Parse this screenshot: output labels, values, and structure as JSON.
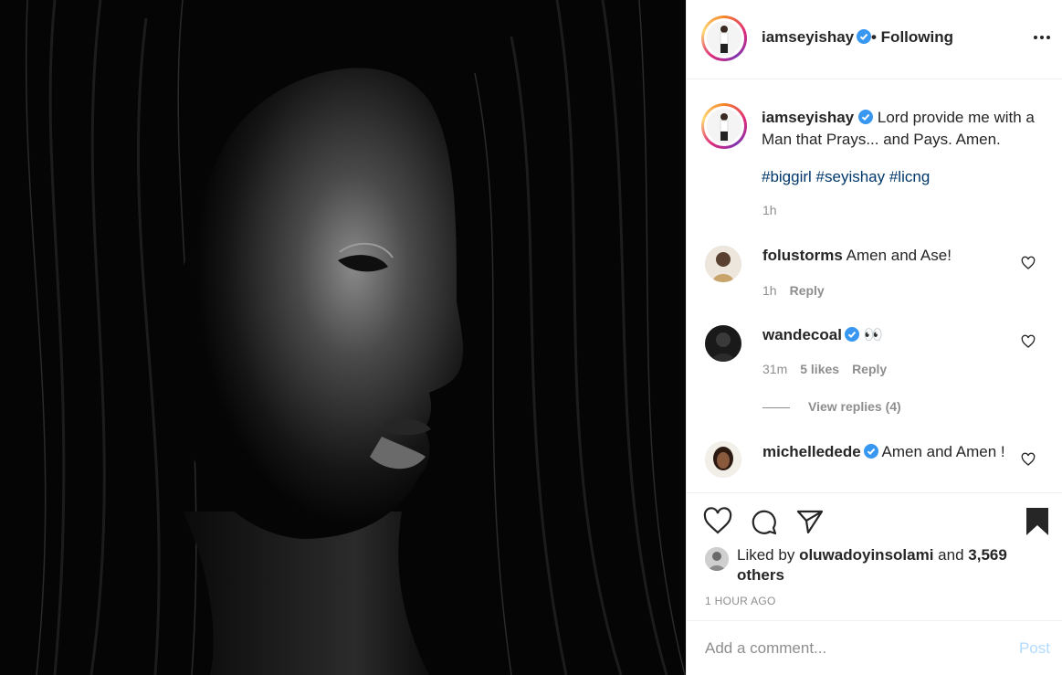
{
  "post_image": {
    "alt": ""
  },
  "header": {
    "username": "iamseyishay",
    "follow_status": "• Following",
    "more_icon": "more-horizontal-icon"
  },
  "caption": {
    "username": "iamseyishay",
    "text": "Lord provide me with a Man that Prays... and Pays. Amen.",
    "hashtags": "#biggirl #seyishay #licng",
    "time": "1h"
  },
  "comments": [
    {
      "username": "folustorms",
      "text": "Amen and Ase!",
      "time": "1h",
      "likes": "",
      "reply": "Reply",
      "verified": false
    },
    {
      "username": "wandecoal",
      "text": "👀",
      "time": "31m",
      "likes": "5 likes",
      "reply": "Reply",
      "verified": true
    },
    {
      "username": "michelledede",
      "text": "Amen and Amen !",
      "time": "",
      "likes": "",
      "reply": "",
      "verified": true
    }
  ],
  "view_replies": "View replies (4)",
  "likes": {
    "prefix": "Liked by",
    "user": "oluwadoyinsolami",
    "suffix": "and",
    "others": "3,569 others"
  },
  "post_time": "1 HOUR AGO",
  "add_comment": {
    "placeholder": "Add a comment...",
    "post_label": "Post"
  },
  "colors": {
    "link": "#00376b",
    "verified": "#3897f0",
    "muted": "#8e8e8e",
    "post_disabled": "#b3dbff"
  }
}
